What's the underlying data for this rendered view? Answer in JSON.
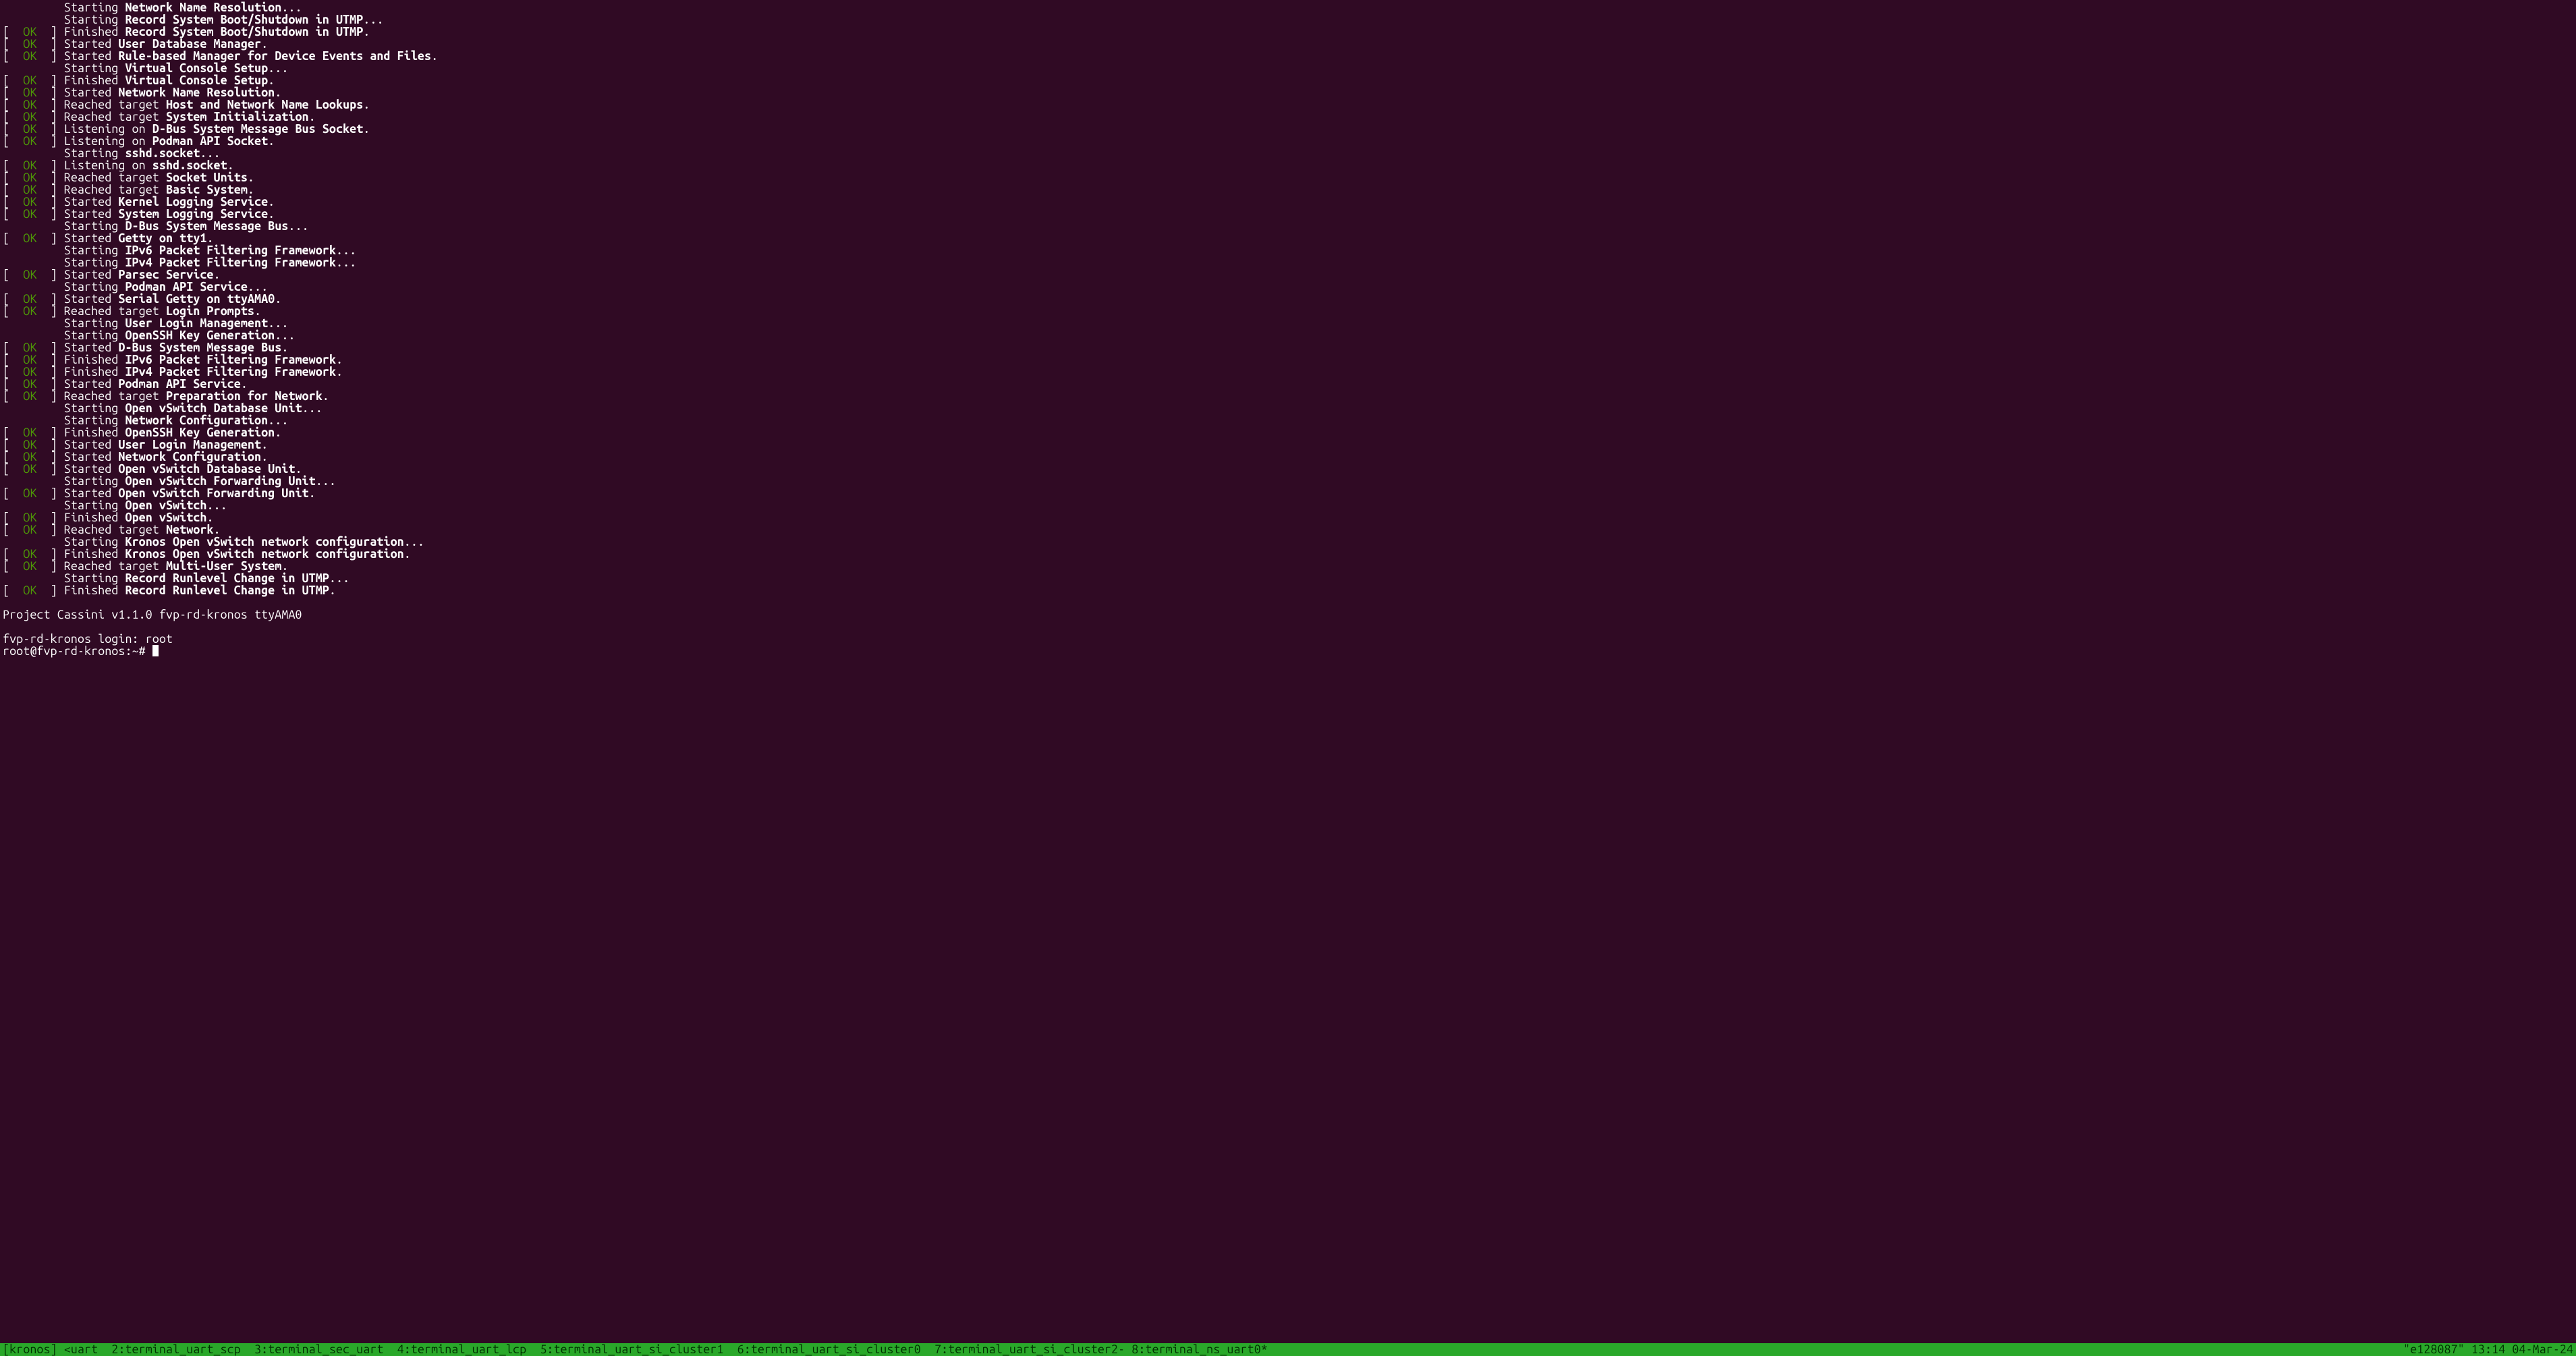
{
  "lines": [
    {
      "status": null,
      "prefix": "Starting ",
      "bold": "Network Name Resolution",
      "suffix": "..."
    },
    {
      "status": null,
      "prefix": "Starting ",
      "bold": "Record System Boot/Shutdown in UTMP",
      "suffix": "..."
    },
    {
      "status": "OK",
      "prefix": "Finished ",
      "bold": "Record System Boot/Shutdown in UTMP",
      "suffix": "."
    },
    {
      "status": "OK",
      "prefix": "Started ",
      "bold": "User Database Manager",
      "suffix": "."
    },
    {
      "status": "OK",
      "prefix": "Started ",
      "bold": "Rule-based Manager for Device Events and Files",
      "suffix": "."
    },
    {
      "status": null,
      "prefix": "Starting ",
      "bold": "Virtual Console Setup",
      "suffix": "..."
    },
    {
      "status": "OK",
      "prefix": "Finished ",
      "bold": "Virtual Console Setup",
      "suffix": "."
    },
    {
      "status": "OK",
      "prefix": "Started ",
      "bold": "Network Name Resolution",
      "suffix": "."
    },
    {
      "status": "OK",
      "prefix": "Reached target ",
      "bold": "Host and Network Name Lookups",
      "suffix": "."
    },
    {
      "status": "OK",
      "prefix": "Reached target ",
      "bold": "System Initialization",
      "suffix": "."
    },
    {
      "status": "OK",
      "prefix": "Listening on ",
      "bold": "D-Bus System Message Bus Socket",
      "suffix": "."
    },
    {
      "status": "OK",
      "prefix": "Listening on ",
      "bold": "Podman API Socket",
      "suffix": "."
    },
    {
      "status": null,
      "prefix": "Starting ",
      "bold": "sshd.socket",
      "suffix": "..."
    },
    {
      "status": "OK",
      "prefix": "Listening on ",
      "bold": "sshd.socket",
      "suffix": "."
    },
    {
      "status": "OK",
      "prefix": "Reached target ",
      "bold": "Socket Units",
      "suffix": "."
    },
    {
      "status": "OK",
      "prefix": "Reached target ",
      "bold": "Basic System",
      "suffix": "."
    },
    {
      "status": "OK",
      "prefix": "Started ",
      "bold": "Kernel Logging Service",
      "suffix": "."
    },
    {
      "status": "OK",
      "prefix": "Started ",
      "bold": "System Logging Service",
      "suffix": "."
    },
    {
      "status": null,
      "prefix": "Starting ",
      "bold": "D-Bus System Message Bus",
      "suffix": "..."
    },
    {
      "status": "OK",
      "prefix": "Started ",
      "bold": "Getty on tty1",
      "suffix": "."
    },
    {
      "status": null,
      "prefix": "Starting ",
      "bold": "IPv6 Packet Filtering Framework",
      "suffix": "..."
    },
    {
      "status": null,
      "prefix": "Starting ",
      "bold": "IPv4 Packet Filtering Framework",
      "suffix": "..."
    },
    {
      "status": "OK",
      "prefix": "Started ",
      "bold": "Parsec Service",
      "suffix": "."
    },
    {
      "status": null,
      "prefix": "Starting ",
      "bold": "Podman API Service",
      "suffix": "..."
    },
    {
      "status": "OK",
      "prefix": "Started ",
      "bold": "Serial Getty on ttyAMA0",
      "suffix": "."
    },
    {
      "status": "OK",
      "prefix": "Reached target ",
      "bold": "Login Prompts",
      "suffix": "."
    },
    {
      "status": null,
      "prefix": "Starting ",
      "bold": "User Login Management",
      "suffix": "..."
    },
    {
      "status": null,
      "prefix": "Starting ",
      "bold": "OpenSSH Key Generation",
      "suffix": "..."
    },
    {
      "status": "OK",
      "prefix": "Started ",
      "bold": "D-Bus System Message Bus",
      "suffix": "."
    },
    {
      "status": "OK",
      "prefix": "Finished ",
      "bold": "IPv6 Packet Filtering Framework",
      "suffix": "."
    },
    {
      "status": "OK",
      "prefix": "Finished ",
      "bold": "IPv4 Packet Filtering Framework",
      "suffix": "."
    },
    {
      "status": "OK",
      "prefix": "Started ",
      "bold": "Podman API Service",
      "suffix": "."
    },
    {
      "status": "OK",
      "prefix": "Reached target ",
      "bold": "Preparation for Network",
      "suffix": "."
    },
    {
      "status": null,
      "prefix": "Starting ",
      "bold": "Open vSwitch Database Unit",
      "suffix": "..."
    },
    {
      "status": null,
      "prefix": "Starting ",
      "bold": "Network Configuration",
      "suffix": "..."
    },
    {
      "status": "OK",
      "prefix": "Finished ",
      "bold": "OpenSSH Key Generation",
      "suffix": "."
    },
    {
      "status": "OK",
      "prefix": "Started ",
      "bold": "User Login Management",
      "suffix": "."
    },
    {
      "status": "OK",
      "prefix": "Started ",
      "bold": "Network Configuration",
      "suffix": "."
    },
    {
      "status": "OK",
      "prefix": "Started ",
      "bold": "Open vSwitch Database Unit",
      "suffix": "."
    },
    {
      "status": null,
      "prefix": "Starting ",
      "bold": "Open vSwitch Forwarding Unit",
      "suffix": "..."
    },
    {
      "status": "OK",
      "prefix": "Started ",
      "bold": "Open vSwitch Forwarding Unit",
      "suffix": "."
    },
    {
      "status": null,
      "prefix": "Starting ",
      "bold": "Open vSwitch",
      "suffix": "..."
    },
    {
      "status": "OK",
      "prefix": "Finished ",
      "bold": "Open vSwitch",
      "suffix": "."
    },
    {
      "status": "OK",
      "prefix": "Reached target ",
      "bold": "Network",
      "suffix": "."
    },
    {
      "status": null,
      "prefix": "Starting ",
      "bold": "Kronos Open vSwitch network configuration",
      "suffix": "..."
    },
    {
      "status": "OK",
      "prefix": "Finished ",
      "bold": "Kronos Open vSwitch network configuration",
      "suffix": "."
    },
    {
      "status": "OK",
      "prefix": "Reached target ",
      "bold": "Multi-User System",
      "suffix": "."
    },
    {
      "status": null,
      "prefix": "Starting ",
      "bold": "Record Runlevel Change in UTMP",
      "suffix": "..."
    },
    {
      "status": "OK",
      "prefix": "Finished ",
      "bold": "Record Runlevel Change in UTMP",
      "suffix": "."
    }
  ],
  "blank1": "",
  "banner": "Project Cassini v1.1.0 fvp-rd-kronos ttyAMA0",
  "blank2": "",
  "login_line": "fvp-rd-kronos login: root",
  "prompt_text": "root@fvp-rd-kronos:~# ",
  "status_left": "[kronos] <uart  2:terminal_uart_scp  3:terminal_sec_uart  4:terminal_uart_lcp  5:terminal_uart_si_cluster1  6:terminal_uart_si_cluster0  7:terminal_uart_si_cluster2- 8:terminal_ns_uart0*",
  "status_right": "\"e128087\" 13:14 04-Mar-24"
}
